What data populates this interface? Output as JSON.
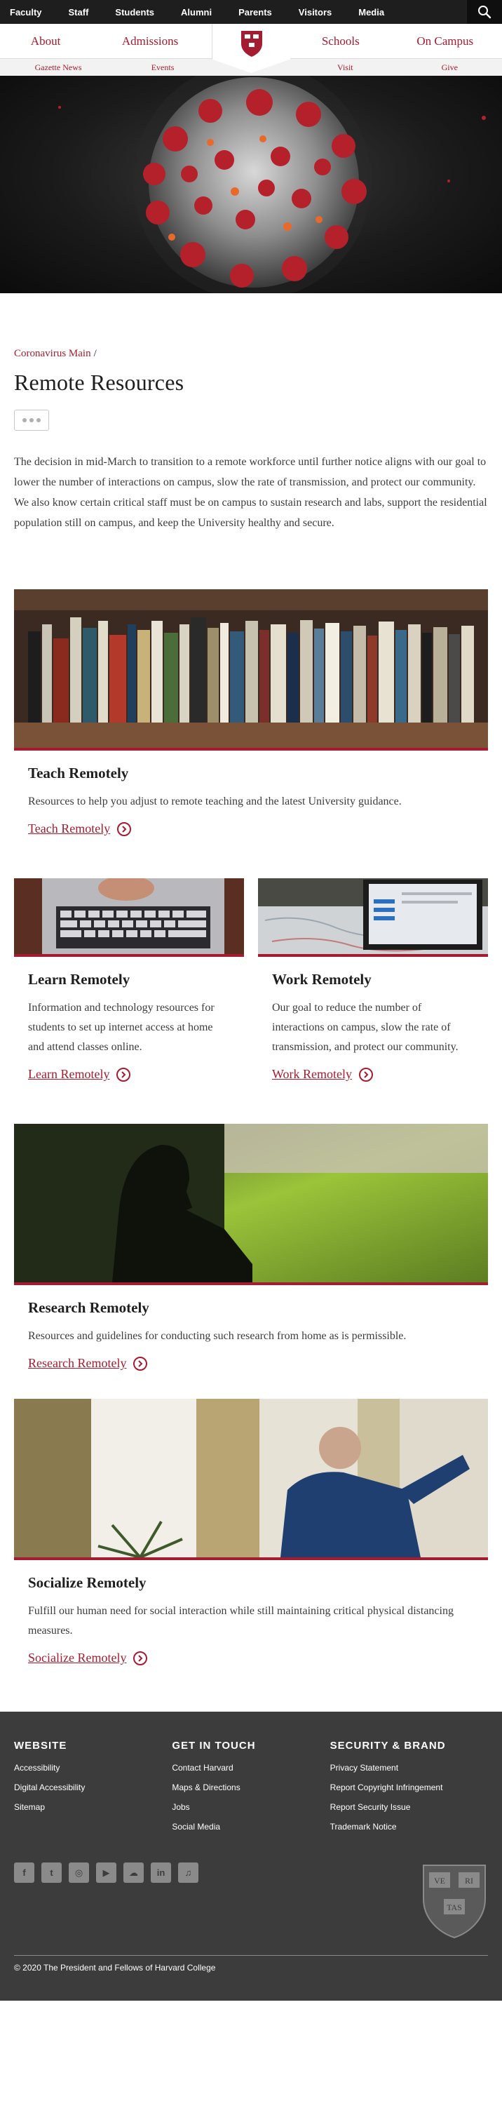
{
  "topbar": {
    "items": [
      "Faculty",
      "Staff",
      "Students",
      "Alumni",
      "Parents",
      "Visitors",
      "Media"
    ],
    "search_icon": "search-icon"
  },
  "mainnav": {
    "left": [
      "About",
      "Admissions"
    ],
    "right": [
      "Schools",
      "On Campus"
    ],
    "logo": "harvard-shield-logo"
  },
  "subnav": {
    "left": [
      "Gazette News",
      "Events"
    ],
    "right": [
      "Visit",
      "Give"
    ]
  },
  "breadcrumb": {
    "parent": "Coronavirus Main",
    "separator": "/"
  },
  "page": {
    "title": "Remote Resources",
    "intro": "The decision in mid-March to transition to a remote workforce until further notice aligns with our goal to lower the number of interactions on campus, slow the rate of transmission, and protect our community. We also know certain critical staff must be on campus to sustain research and labs, support the residential population still on campus, and keep the University healthy and secure."
  },
  "cards": {
    "teach": {
      "title": "Teach Remotely",
      "desc": "Resources to help you adjust to remote teaching and the latest University guidance.",
      "link": "Teach Remotely"
    },
    "learn": {
      "title": "Learn Remotely",
      "desc": "Information and technology resources for students to set up internet access at home and attend classes online.",
      "link": "Learn Remotely"
    },
    "work": {
      "title": "Work Remotely",
      "desc": "Our goal to reduce the number of interactions on campus, slow the rate of transmission, and protect our community.",
      "link": "Work Remotely"
    },
    "research": {
      "title": "Research Remotely",
      "desc": "Resources and guidelines for conducting such research from home as is permissible.",
      "link": "Research Remotely"
    },
    "socialize": {
      "title": "Socialize Remotely",
      "desc": "Fulfill our human need for social interaction while still maintaining critical physical distancing measures.",
      "link": "Socialize Remotely"
    }
  },
  "footer": {
    "website": {
      "heading": "WEBSITE",
      "links": [
        "Accessibility",
        "Digital Accessibility",
        "Sitemap"
      ]
    },
    "contact": {
      "heading": "GET IN TOUCH",
      "links": [
        "Contact Harvard",
        "Maps & Directions",
        "Jobs",
        "Social Media"
      ]
    },
    "brand": {
      "heading": "SECURITY & BRAND",
      "links": [
        "Privacy Statement",
        "Report Copyright Infringement",
        "Report Security Issue",
        "Trademark Notice"
      ]
    },
    "social_icons": [
      "facebook-icon",
      "twitter-icon",
      "instagram-icon",
      "youtube-icon",
      "soundcloud-icon",
      "linkedin-icon",
      "itunes-icon"
    ],
    "veritas": [
      "VE",
      "RI",
      "TAS"
    ],
    "copyright": "© 2020 The President and Fellows of Harvard College"
  },
  "colors": {
    "crimson": "#a51c30",
    "topbar": "#1e1e1e",
    "footer": "#3c3c3c"
  }
}
